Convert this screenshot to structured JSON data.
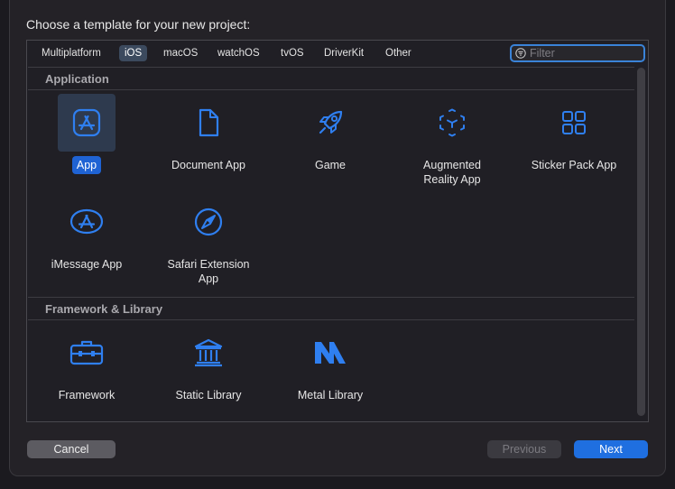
{
  "dialog": {
    "prompt": "Choose a template for your new project:"
  },
  "tabs": [
    {
      "label": "Multiplatform"
    },
    {
      "label": "iOS",
      "active": true
    },
    {
      "label": "macOS"
    },
    {
      "label": "watchOS"
    },
    {
      "label": "tvOS"
    },
    {
      "label": "DriverKit"
    },
    {
      "label": "Other"
    }
  ],
  "filter": {
    "placeholder": "Filter",
    "icon": "filter-icon"
  },
  "sections": [
    {
      "title": "Application",
      "items": [
        {
          "label": "App",
          "icon": "app-store-icon",
          "selected": true
        },
        {
          "label": "Document App",
          "icon": "document-icon"
        },
        {
          "label": "Game",
          "icon": "rocket-icon"
        },
        {
          "label": "Augmented Reality App",
          "line1": "Augmented",
          "line2": "Reality App",
          "icon": "ar-cube-icon"
        },
        {
          "label": "Sticker Pack App",
          "icon": "grid-icon"
        },
        {
          "label": "iMessage App",
          "icon": "imessage-app-icon"
        },
        {
          "label": "Safari Extension App",
          "line1": "Safari Extension",
          "line2": "App",
          "icon": "compass-icon"
        }
      ]
    },
    {
      "title": "Framework & Library",
      "items": [
        {
          "label": "Framework",
          "icon": "toolbox-icon"
        },
        {
          "label": "Static Library",
          "icon": "library-building-icon"
        },
        {
          "label": "Metal Library",
          "icon": "metal-icon"
        }
      ]
    }
  ],
  "buttons": {
    "cancel": "Cancel",
    "previous": "Previous",
    "next": "Next"
  },
  "colors": {
    "accent": "#1f6fe0",
    "icon_blue": "#2f7ff0",
    "background": "#201f25"
  }
}
